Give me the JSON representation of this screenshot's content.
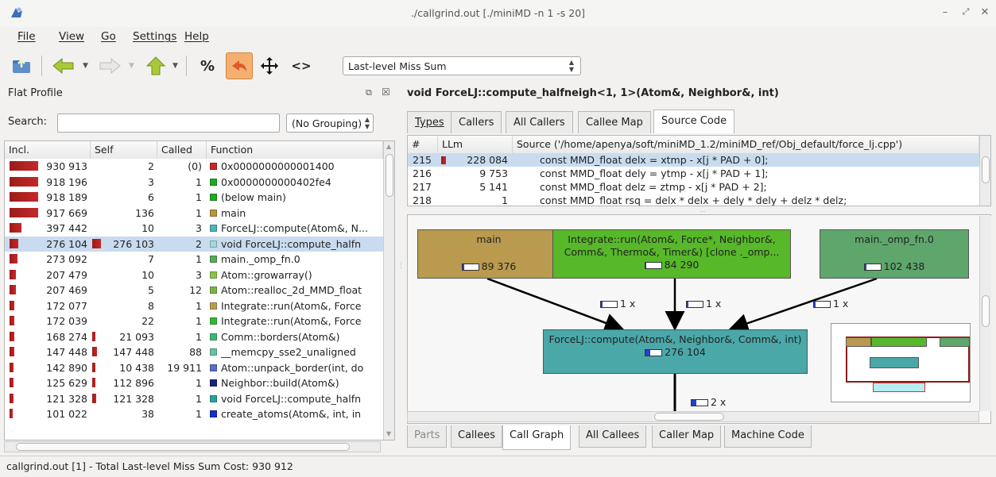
{
  "window": {
    "title": "./callgrind.out [./miniMD -n 1 -s 20]"
  },
  "menu": [
    "File",
    "View",
    "Go",
    "Settings",
    "Help"
  ],
  "toolbar": {
    "percent_label": "%",
    "expand_label": "<>",
    "event_type": "Last-level Miss Sum"
  },
  "flat_profile": {
    "title": "Flat Profile",
    "search_label": "Search:",
    "search_value": "",
    "grouping": "(No Grouping)",
    "columns": [
      "Incl.",
      "Self",
      "Called",
      "Function"
    ],
    "rows": [
      {
        "incl": "930 913",
        "self": "2",
        "called": "(0)",
        "color": "#c62828",
        "function": "0x0000000000001400",
        "incl_frac": 1.0,
        "self_frac": 0
      },
      {
        "incl": "918 196",
        "self": "3",
        "called": "1",
        "color": "#22a822",
        "function": "0x0000000000402fe4",
        "incl_frac": 0.99,
        "self_frac": 0
      },
      {
        "incl": "918 189",
        "self": "6",
        "called": "1",
        "color": "#22a822",
        "function": "(below main)",
        "incl_frac": 0.99,
        "self_frac": 0
      },
      {
        "incl": "917 669",
        "self": "136",
        "called": "1",
        "color": "#b8963e",
        "function": "main",
        "incl_frac": 0.99,
        "self_frac": 0
      },
      {
        "incl": "397 442",
        "self": "10",
        "called": "3",
        "color": "#4db6b6",
        "function": "ForceLJ::compute(Atom&, N...",
        "incl_frac": 0.43,
        "self_frac": 0
      },
      {
        "incl": "276 104",
        "self": "276 103",
        "called": "2",
        "color": "#9fd8e0",
        "function": "void ForceLJ::compute_halfn",
        "incl_frac": 0.3,
        "self_frac": 0.3,
        "selected": true
      },
      {
        "incl": "273 092",
        "self": "7",
        "called": "1",
        "color": "#5aaa5a",
        "function": "main._omp_fn.0",
        "incl_frac": 0.29,
        "self_frac": 0
      },
      {
        "incl": "207 479",
        "self": "10",
        "called": "3",
        "color": "#8bc34a",
        "function": "Atom::growarray()",
        "incl_frac": 0.22,
        "self_frac": 0
      },
      {
        "incl": "207 469",
        "self": "5",
        "called": "12",
        "color": "#7cb342",
        "function": "Atom::realloc_2d_MMD_float",
        "incl_frac": 0.22,
        "self_frac": 0
      },
      {
        "incl": "172 077",
        "self": "8",
        "called": "1",
        "color": "#b8a050",
        "function": "Integrate::run(Atom&, Force",
        "incl_frac": 0.18,
        "self_frac": 0
      },
      {
        "incl": "172 039",
        "self": "22",
        "called": "1",
        "color": "#33b833",
        "function": "Integrate::run(Atom&, Force",
        "incl_frac": 0.18,
        "self_frac": 0
      },
      {
        "incl": "168 274",
        "self": "21 093",
        "called": "1",
        "color": "#3cb878",
        "function": "Comm::borders(Atom&)",
        "incl_frac": 0.18,
        "self_frac": 0.02
      },
      {
        "incl": "147 448",
        "self": "147 448",
        "called": "88",
        "color": "#66c2a0",
        "function": "__memcpy_sse2_unaligned",
        "incl_frac": 0.16,
        "self_frac": 0.16
      },
      {
        "incl": "142 890",
        "self": "10 438",
        "called": "19 911",
        "color": "#5b6fc0",
        "function": "Atom::unpack_border(int, do",
        "incl_frac": 0.15,
        "self_frac": 0.01
      },
      {
        "incl": "125 629",
        "self": "112 896",
        "called": "1",
        "color": "#1a237e",
        "function": "Neighbor::build(Atom&)",
        "incl_frac": 0.13,
        "self_frac": 0.12
      },
      {
        "incl": "121 328",
        "self": "121 328",
        "called": "1",
        "color": "#26a69a",
        "function": "void ForceLJ::compute_halfn",
        "incl_frac": 0.13,
        "self_frac": 0.13
      },
      {
        "incl": "101 022",
        "self": "38",
        "called": "1",
        "color": "#1530c8",
        "function": "create_atoms(Atom&, int, in",
        "incl_frac": 0.11,
        "self_frac": 0
      }
    ]
  },
  "detail": {
    "function_title": "void ForceLJ::compute_halfneigh<1, 1>(Atom&, Neighbor&, int)",
    "top_tabs": [
      "Types",
      "Callers",
      "All Callers",
      "Callee Map",
      "Source Code"
    ],
    "active_top_tab": "Source Code",
    "source_columns": [
      "#",
      "LLm",
      "Source ('/home/apenya/soft/miniMD_1.2/miniMD_ref/Obj_default/force_lj.cpp')"
    ],
    "source_rows": [
      {
        "line": "215",
        "cost": "228 084",
        "code": "const MMD_float delx = xtmp - x[j * PAD + 0];",
        "selected": true,
        "bar": true
      },
      {
        "line": "216",
        "cost": "9 753",
        "code": "const MMD_float dely = ytmp - x[j * PAD + 1];"
      },
      {
        "line": "217",
        "cost": "5 141",
        "code": "const MMD_float delz = ztmp - x[j * PAD + 2];"
      },
      {
        "line": "218",
        "cost": "1",
        "code": "const MMD_float rsq = delx * delx + dely * dely + delz * delz;"
      }
    ],
    "graph": {
      "nodes": {
        "main": {
          "label": "main",
          "cost": "89 376",
          "color": "#b99a4e",
          "fill_frac": 0.1
        },
        "integrate": {
          "label": "Integrate::run(Atom&, Force*, Neighbor&, Comm&, Thermo&, Timer&) [clone ._omp...",
          "cost": "84 290",
          "color": "#57b82a",
          "fill_frac": 0.09
        },
        "omp": {
          "label": "main._omp_fn.0",
          "cost": "102 438",
          "color": "#5ea66b",
          "fill_frac": 0.11
        },
        "compute": {
          "label": "ForceLJ::compute(Atom&, Neighbor&, Comm&, int)",
          "cost": "276 104",
          "color": "#4aa8a8",
          "fill_frac": 0.3
        }
      },
      "edges": [
        "1 x",
        "1 x",
        "1 x",
        "2 x"
      ]
    },
    "bottom_tabs": [
      "Parts",
      "Callees",
      "Call Graph",
      "All Callees",
      "Caller Map",
      "Machine Code"
    ],
    "active_bottom_tab": "Call Graph"
  },
  "status": "callgrind.out [1] - Total Last-level Miss Sum Cost: 930 912"
}
